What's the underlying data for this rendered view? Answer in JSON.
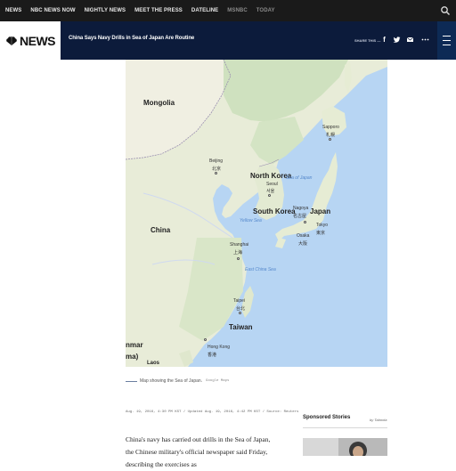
{
  "topnav": {
    "links": [
      "NEWS",
      "NBC NEWS NOW",
      "NIGHTLY NEWS",
      "MEET THE PRESS",
      "DATELINE",
      "MSNBC",
      "TODAY"
    ]
  },
  "header": {
    "logo_text": "NEWS",
    "title": "China Says Navy Drills in Sea of Japan Are Routine",
    "share_label": "SHARE THIS —"
  },
  "map": {
    "countries": {
      "mongolia": "Mongolia",
      "china": "China",
      "north_korea": "North Korea",
      "south_korea": "South Korea",
      "japan": "Japan",
      "taiwan": "Taiwan",
      "myanmar_partial": "nmar",
      "myanmar_partial2": "ma)",
      "laos_partial": "Laos"
    },
    "seas": {
      "sea_of_japan": "Sea of Japan",
      "yellow_sea": "Yellow Sea",
      "east_china_sea": "East China Sea"
    },
    "cities": {
      "beijing": "Beijing",
      "beijing_cn": "北京",
      "seoul": "Seoul",
      "seoul_kr": "서울",
      "sapporo": "Sapporo",
      "sapporo_jp": "札幌",
      "nagoya": "Nagoya",
      "nagoya_jp": "名古屋",
      "tokyo": "Tokyo",
      "tokyo_jp": "東京",
      "osaka": "Osaka",
      "osaka_jp": "大阪",
      "shanghai": "Shanghai",
      "shanghai_cn": "上海",
      "taipei": "Taipei",
      "taipei_cn": "台北",
      "hong_kong": "Hong Kong",
      "hong_kong_cn": "香港"
    }
  },
  "caption": {
    "text": "Map showing the Sea of Japan.",
    "credit": "Google Maps"
  },
  "article": {
    "meta": "Aug. 19, 2016, 4:30 PM KST / Updated Aug. 19, 2016, 4:42 PM KST / Source: Reuters",
    "lede": "China's navy has carried out drills in the Sea of Japan, the Chinese military's official newspaper said Friday, describing the exercises as"
  },
  "sponsored": {
    "title": "Sponsored Stories",
    "by": "by Taboola"
  },
  "colors": {
    "topnav_bg": "#1a1a1a",
    "header_bg": "#0c1b3b",
    "water": "#b7d5f3",
    "land": "#e6ead6"
  }
}
